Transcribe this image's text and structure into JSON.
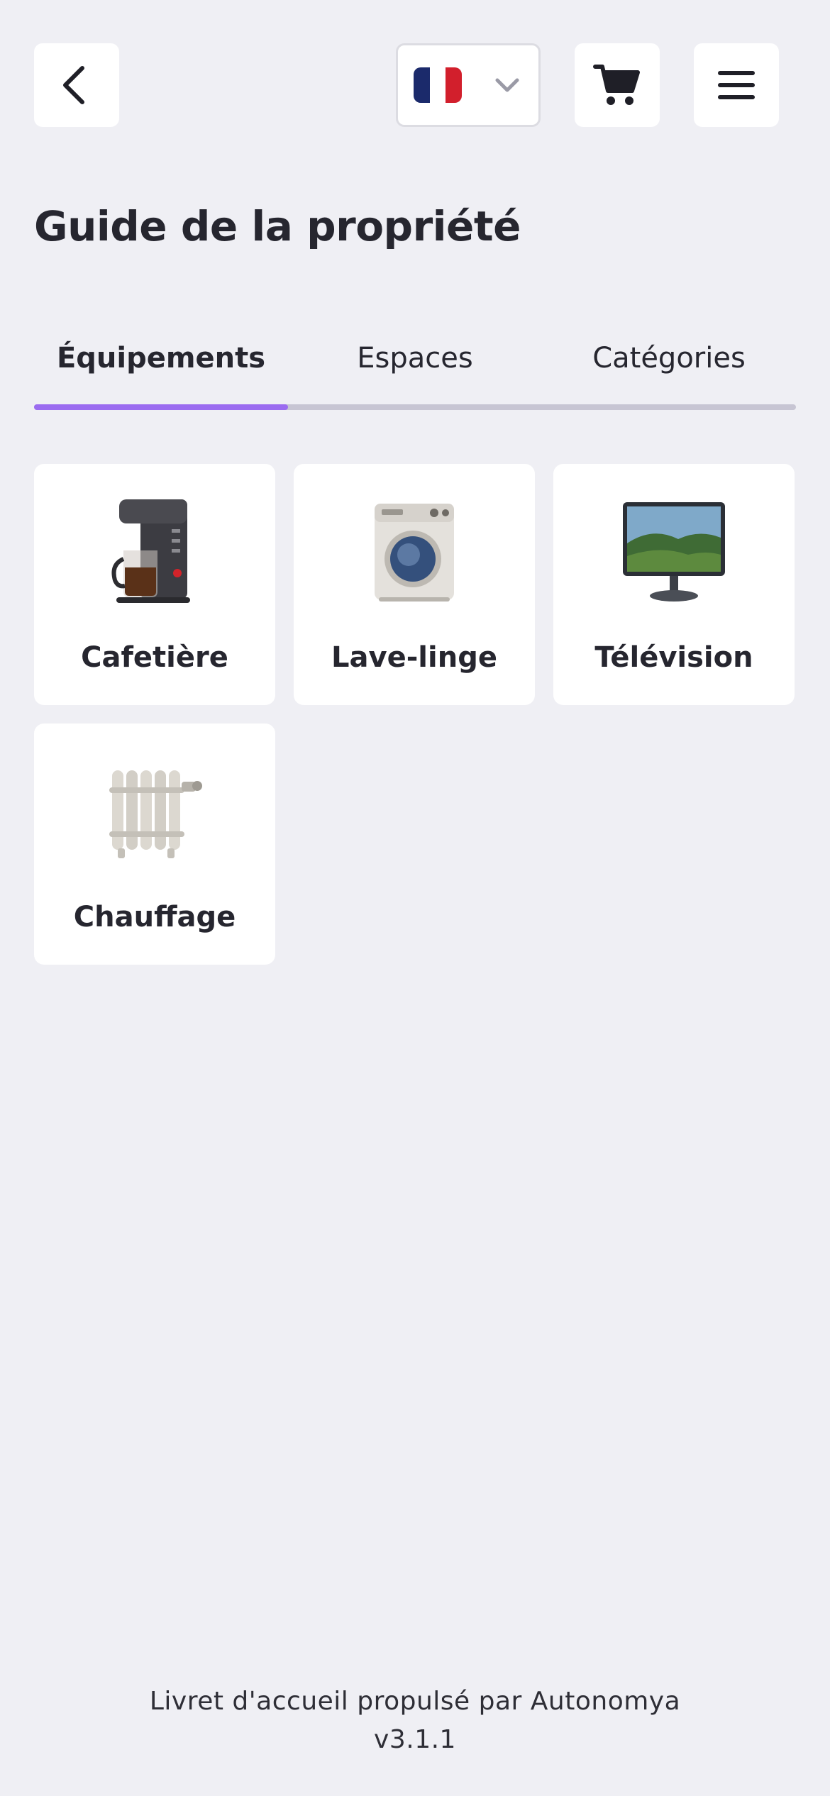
{
  "header": {
    "back_icon": "chevron-left-icon",
    "language": {
      "flag": "france-flag-icon",
      "colors": [
        "#1b2a6b",
        "#ffffff",
        "#d21f2c"
      ]
    },
    "cart_icon": "cart-icon",
    "menu_icon": "hamburger-menu-icon"
  },
  "title": "Guide de la propriété",
  "tabs": [
    {
      "label": "Équipements",
      "active": true
    },
    {
      "label": "Espaces",
      "active": false
    },
    {
      "label": "Catégories",
      "active": false
    }
  ],
  "accent_color": "#9b6cf0",
  "equipment": [
    {
      "label": "Cafetière",
      "icon": "coffee-maker-icon"
    },
    {
      "label": "Lave-linge",
      "icon": "washing-machine-icon"
    },
    {
      "label": "Télévision",
      "icon": "television-icon"
    },
    {
      "label": "Chauffage",
      "icon": "radiator-icon"
    }
  ],
  "footer": {
    "powered_by": "Livret d'accueil propulsé par Autonomya",
    "version": "v3.1.1"
  }
}
